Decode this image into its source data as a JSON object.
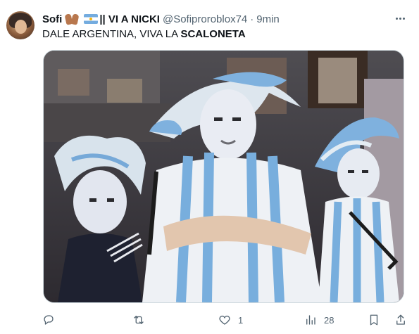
{
  "tweet": {
    "display_name": "Sofi",
    "name_suffix": "|| VI A NICKI",
    "handle": "@Sofiproroblox74",
    "separator": "·",
    "time": "9min",
    "text_prefix": "DALE ARGENTINA, VIVA LA ",
    "text_bold": "SCALONETA",
    "emojis": [
      "pinched-fingers-emoji",
      "argentina-flag-emoji"
    ],
    "media": {
      "description_icon": "photo"
    },
    "actions": {
      "reply_count": "",
      "retweet_count": "",
      "like_count": "1",
      "views_count": "28"
    }
  },
  "colors": {
    "text": "#0f1419",
    "muted": "#536471",
    "border": "#cfd9de",
    "argentina_blue": "#74acdf"
  }
}
